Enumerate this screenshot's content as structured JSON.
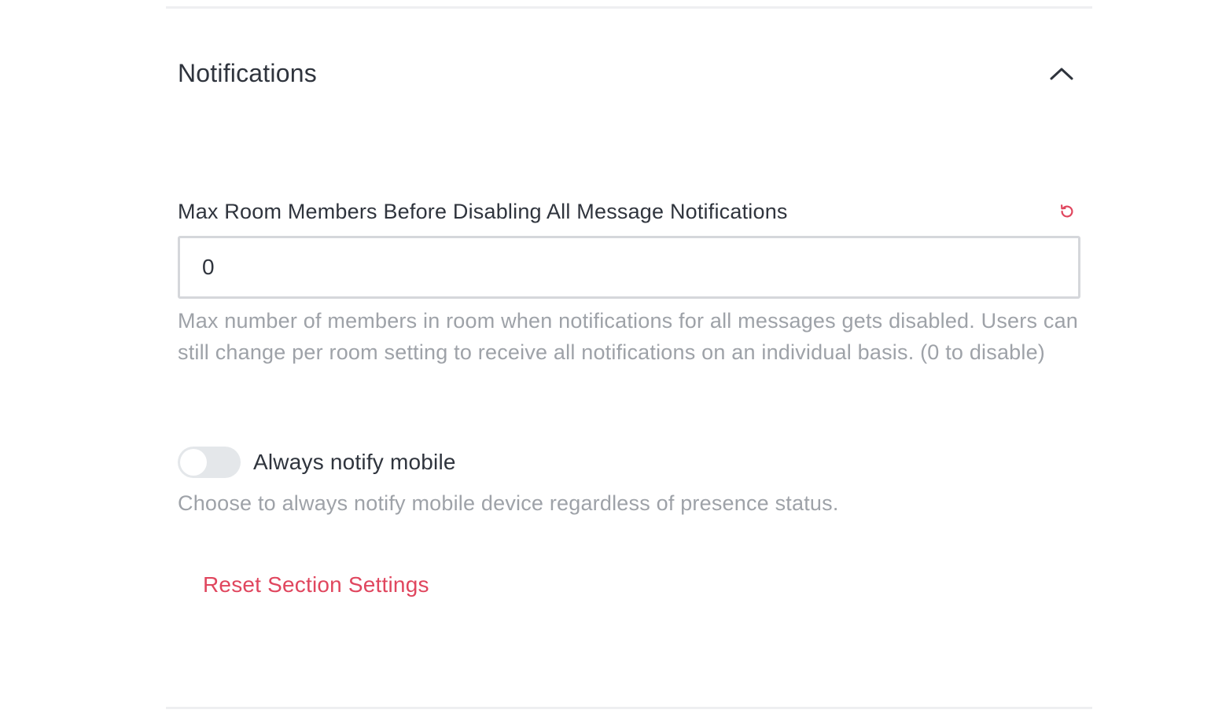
{
  "section": {
    "title": "Notifications",
    "collapse_icon": "chevron-up-icon"
  },
  "max_room_members": {
    "label": "Max Room Members Before Disabling All Message Notifications",
    "reset_icon": "reset-icon",
    "value": "0",
    "hint": "Max number of members in room when notifications for all messages gets disabled. Users can still change per room setting to receive all notifications on an individual basis. (0 to disable)"
  },
  "always_notify_mobile": {
    "label": "Always notify mobile",
    "enabled": false,
    "hint": "Choose to always notify mobile device regardless of presence status."
  },
  "reset_section_label": "Reset Section Settings",
  "colors": {
    "accent_red": "#e0465e",
    "text_primary": "#2f343d",
    "text_hint": "#9ea2a8",
    "toggle_off_bg": "#e4e7ea",
    "border": "#d5d7db"
  }
}
